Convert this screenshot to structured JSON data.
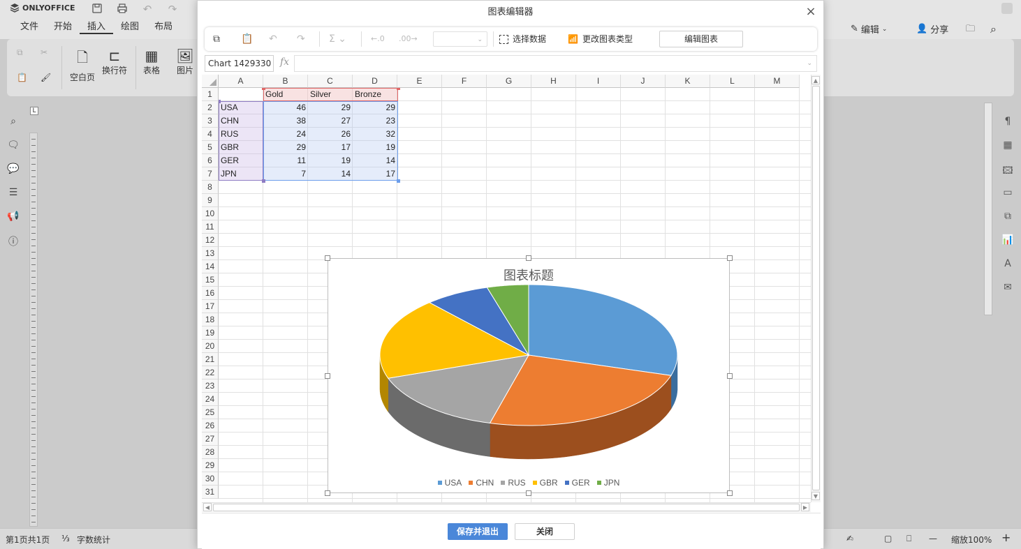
{
  "app": {
    "logo": "ONLYOFFICE",
    "menu_tabs": [
      "文件",
      "开始",
      "插入",
      "绘图",
      "布局"
    ],
    "active_tab": "插入",
    "ribbon": {
      "blank_page": "空白页",
      "line_break": "换行符",
      "table": "表格",
      "image": "图片"
    },
    "edit_mode": "编辑",
    "share": "分享"
  },
  "status_bar": {
    "page_info": "第1页共1页",
    "word_count": "字数统计",
    "zoom": "缩放100%"
  },
  "dialog": {
    "title": "图表编辑器",
    "toolbar": {
      "select_data": "选择数据",
      "change_chart_type": "更改图表类型",
      "edit_chart": "编辑图表"
    },
    "name_box": "Chart 1429330",
    "fx_label": "fx",
    "columns": [
      "A",
      "B",
      "C",
      "D",
      "E",
      "F",
      "G",
      "H",
      "I",
      "J",
      "K",
      "L",
      "M"
    ],
    "rows": [
      "1",
      "2",
      "3",
      "4",
      "5",
      "6",
      "7",
      "8",
      "9",
      "10",
      "11",
      "12",
      "13",
      "14",
      "15",
      "16",
      "17",
      "18",
      "19",
      "20",
      "21",
      "22",
      "23",
      "24",
      "25",
      "26",
      "27",
      "28",
      "29",
      "30",
      "31"
    ],
    "table": {
      "headers": [
        "Gold",
        "Silver",
        "Bronze"
      ],
      "rows": [
        {
          "label": "USA",
          "gold": "46",
          "silver": "29",
          "bronze": "29"
        },
        {
          "label": "CHN",
          "gold": "38",
          "silver": "27",
          "bronze": "23"
        },
        {
          "label": "RUS",
          "gold": "24",
          "silver": "26",
          "bronze": "32"
        },
        {
          "label": "GBR",
          "gold": "29",
          "silver": "17",
          "bronze": "19"
        },
        {
          "label": "GER",
          "gold": "11",
          "silver": "19",
          "bronze": "14"
        },
        {
          "label": "JPN",
          "gold": "7",
          "silver": "14",
          "bronze": "17"
        }
      ]
    },
    "save_exit": "保存并退出",
    "close": "关闭"
  },
  "chart_data": {
    "type": "pie",
    "title": "图表标题",
    "categories": [
      "USA",
      "CHN",
      "RUS",
      "GBR",
      "GER",
      "JPN"
    ],
    "series": [
      {
        "name": "Gold",
        "values": [
          46,
          38,
          24,
          29,
          11,
          7
        ]
      }
    ],
    "colors": [
      "#5b9bd5",
      "#ed7d31",
      "#a5a5a5",
      "#ffc000",
      "#4472c4",
      "#70ad47"
    ],
    "side_colors": [
      "#3a6d9e",
      "#9c4f1e",
      "#6b6b6b",
      "#b38600",
      "#2e4d87",
      "#4a7a2e"
    ],
    "legend": "bottom",
    "style": "3d"
  }
}
